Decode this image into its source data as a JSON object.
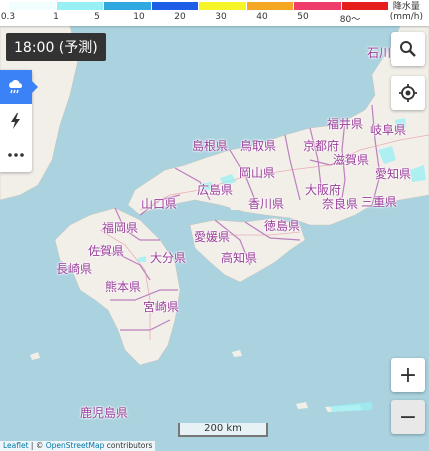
{
  "legend": {
    "ticks": [
      "0.3",
      "1",
      "5",
      "10",
      "20",
      "30",
      "40",
      "50",
      "80～"
    ],
    "colors": [
      "#f2fdfd",
      "#98f0f4",
      "#2fa9e0",
      "#1e5ee6",
      "#f5f52a",
      "#f5a623",
      "#f03c6a",
      "#e61e1e",
      "#9b1f8c"
    ],
    "unit_title": "降水量",
    "unit": "(mm/h)"
  },
  "time_label": "18:00 (予測)",
  "side_panel": {
    "items": [
      {
        "icon": "rain-cloud-icon"
      },
      {
        "icon": "lightning-icon"
      },
      {
        "icon": "more-icon"
      }
    ]
  },
  "controls": {
    "search_icon": "search-icon",
    "locate_icon": "locate-icon",
    "zoom_in": "+",
    "zoom_out": "−"
  },
  "map": {
    "prefectures": [
      "石川",
      "福井県",
      "岐阜県",
      "島根県",
      "鳥取県",
      "京都府",
      "滋賀県",
      "岡山県",
      "愛知県",
      "広島県",
      "大阪府",
      "山口県",
      "香川県",
      "奈良県",
      "三重県",
      "福岡県",
      "愛媛県",
      "徳島県",
      "佐賀県",
      "大分県",
      "高知県",
      "長崎県",
      "熊本県",
      "宮崎県",
      "鹿児島県"
    ],
    "colors": {
      "sea": "#aad3df",
      "land": "#f2efe9",
      "border": "#b36cb8",
      "rain": "#98f0f4"
    }
  },
  "scale_bar": "200 km",
  "attribution": {
    "leaflet": "Leaflet",
    "sep": " | © ",
    "osm": "OpenStreetMap",
    "tail": " contributors"
  }
}
